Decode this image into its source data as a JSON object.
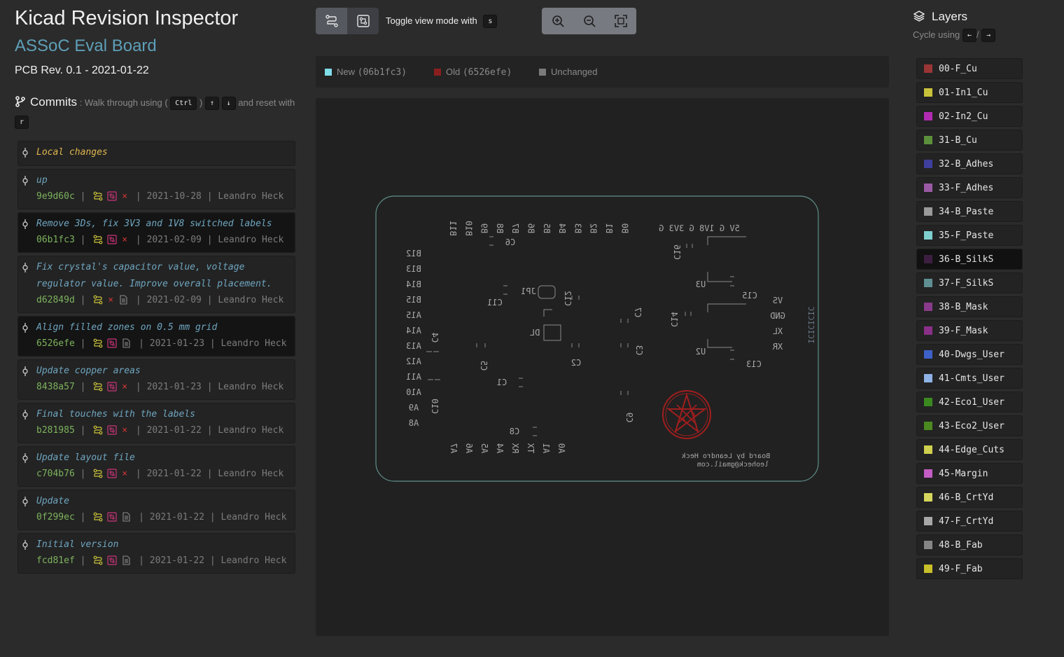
{
  "header": {
    "app_title": "Kicad Revision Inspector",
    "board_name": "ASSoC Eval Board",
    "pcb_rev": "PCB Rev. 0.1 - 2021-01-22"
  },
  "commits_panel": {
    "title": "Commits",
    "hint_1": ": Walk through using (",
    "key_ctrl": "Ctrl",
    "hint_2": ")",
    "key_up": "↑",
    "key_down": "↓",
    "hint_3": "and reset with",
    "key_reset": "r",
    "local_changes_label": "Local changes",
    "commits": [
      {
        "message": "up",
        "hash": "9e9d60c",
        "date": "2021-10-28",
        "author": "Leandro Heck",
        "has_sch": true,
        "has_pcb": true,
        "has_doc": false
      },
      {
        "message": "Remove 3Ds, fix 3V3 and 1V8 switched labels",
        "hash": "06b1fc3",
        "date": "2021-02-09",
        "author": "Leandro Heck",
        "has_sch": true,
        "has_pcb": true,
        "has_doc": false
      },
      {
        "message": "Fix crystal's capacitor value, voltage regulator value. Improve overall placement.",
        "hash": "d62849d",
        "date": "2021-02-09",
        "author": "Leandro Heck",
        "has_sch": true,
        "has_pcb": false,
        "has_doc": true
      },
      {
        "message": "Align filled zones on 0.5 mm grid",
        "hash": "6526efe",
        "date": "2021-01-23",
        "author": "Leandro Heck",
        "has_sch": true,
        "has_pcb": true,
        "has_doc": true
      },
      {
        "message": "Update copper areas",
        "hash": "8438a57",
        "date": "2021-01-23",
        "author": "Leandro Heck",
        "has_sch": true,
        "has_pcb": true,
        "has_doc": false
      },
      {
        "message": "Final touches with the labels",
        "hash": "b281985",
        "date": "2021-01-22",
        "author": "Leandro Heck",
        "has_sch": true,
        "has_pcb": true,
        "has_doc": false
      },
      {
        "message": "Update layout file",
        "hash": "c704b76",
        "date": "2021-01-22",
        "author": "Leandro Heck",
        "has_sch": true,
        "has_pcb": true,
        "has_doc": false
      },
      {
        "message": "Update",
        "hash": "0f299ec",
        "date": "2021-01-22",
        "author": "Leandro Heck",
        "has_sch": true,
        "has_pcb": true,
        "has_doc": true
      },
      {
        "message": "Initial version",
        "hash": "fcd81ef",
        "date": "2021-01-22",
        "author": "Leandro Heck",
        "has_sch": true,
        "has_pcb": true,
        "has_doc": true
      }
    ]
  },
  "toolbar": {
    "toggle_hint": "Toggle view mode with",
    "toggle_key": "s"
  },
  "legend": {
    "new_label": "New",
    "new_hash": "(06b1fc3)",
    "new_color": "#7fdde8",
    "old_label": "Old",
    "old_hash": "(6526efe)",
    "old_color": "#8a1e1e",
    "unchanged_label": "Unchanged",
    "unchanged_color": "#7a7a7a"
  },
  "board": {
    "top_pins": [
      "B11",
      "B10",
      "B9",
      "B8",
      "B7",
      "B6",
      "B5",
      "B4",
      "B3",
      "B2",
      "B1",
      "B0"
    ],
    "power_pins": "5V  G 1V8 G 3V3 G",
    "left_pins": [
      "B12",
      "B13",
      "B14",
      "B15",
      "A15",
      "A14",
      "A13",
      "A12",
      "A11",
      "A10",
      "A9",
      "A8"
    ],
    "bottom_pins": [
      "A7",
      "A6",
      "A5",
      "A4",
      "RX",
      "TX",
      "A1",
      "A0"
    ],
    "right_pins": [
      "VS",
      "GND",
      "XL",
      "XR"
    ],
    "refs": [
      "C16",
      "C6",
      "C11",
      "JP1",
      "C12",
      "U3",
      "C15",
      "C7",
      "C14",
      "DL",
      "C4",
      "C2",
      "C3",
      "U2",
      "C13",
      "C5",
      "C1",
      "C10",
      "C9",
      "C8"
    ],
    "side_text": "ICICICIC",
    "credit_1": "Board by Leandro Heck",
    "credit_2": "leoheck@gmail.com"
  },
  "layers_panel": {
    "title": "Layers",
    "hint": "Cycle using",
    "key_left": "←",
    "sep": "/",
    "key_right": "→",
    "layers": [
      {
        "name": "00-F_Cu",
        "color": "#9a3535"
      },
      {
        "name": "01-In1_Cu",
        "color": "#c9c23a"
      },
      {
        "name": "02-In2_Cu",
        "color": "#b22bb2"
      },
      {
        "name": "31-B_Cu",
        "color": "#5c8f3c"
      },
      {
        "name": "32-B_Adhes",
        "color": "#3f3f9e"
      },
      {
        "name": "33-F_Adhes",
        "color": "#9a5aa3"
      },
      {
        "name": "34-B_Paste",
        "color": "#9a9a9a"
      },
      {
        "name": "35-F_Paste",
        "color": "#7fcfcf"
      },
      {
        "name": "36-B_SilkS",
        "color": "#3c1f40"
      },
      {
        "name": "37-F_SilkS",
        "color": "#5f8f93"
      },
      {
        "name": "38-B_Mask",
        "color": "#8a3a8a"
      },
      {
        "name": "39-F_Mask",
        "color": "#8a2f8a"
      },
      {
        "name": "40-Dwgs_User",
        "color": "#3d60c9"
      },
      {
        "name": "41-Cmts_User",
        "color": "#8fb3e6"
      },
      {
        "name": "42-Eco1_User",
        "color": "#3a8a20"
      },
      {
        "name": "43-Eco2_User",
        "color": "#4a8a20"
      },
      {
        "name": "44-Edge_Cuts",
        "color": "#cfcf4f"
      },
      {
        "name": "45-Margin",
        "color": "#c45cc4"
      },
      {
        "name": "46-B_CrtYd",
        "color": "#d6d65f"
      },
      {
        "name": "47-F_CrtYd",
        "color": "#a8a8a8"
      },
      {
        "name": "48-B_Fab",
        "color": "#858585"
      },
      {
        "name": "49-F_Fab",
        "color": "#c9bf2a"
      }
    ]
  }
}
